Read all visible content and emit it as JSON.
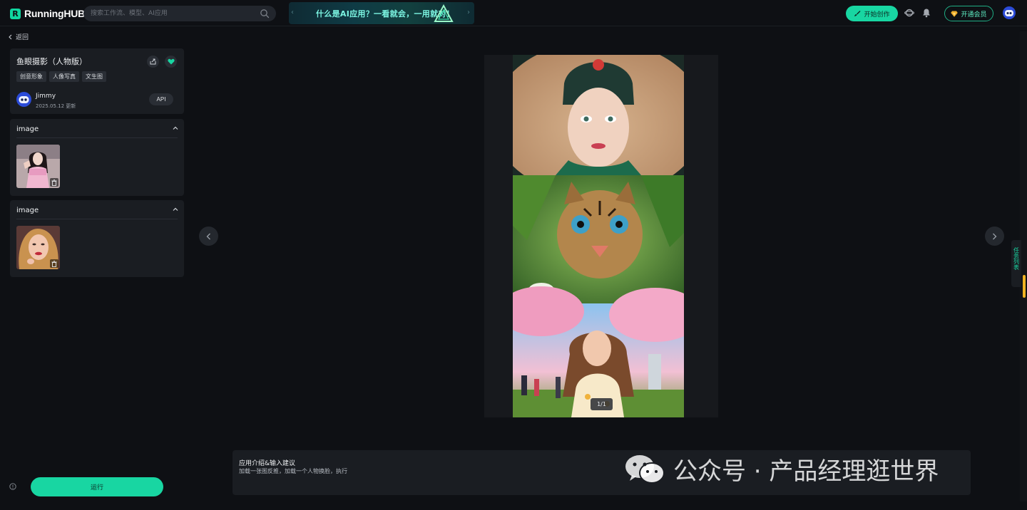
{
  "header": {
    "logo_text": "RunningHUB",
    "logo_mark": "R",
    "search_placeholder": "搜索工作流、模型、AI应用",
    "banner_text": "什么是AI应用？一看就会，一用就对！",
    "banner_prev": "‹",
    "banner_next": "›",
    "create_label": "开始创作",
    "vip_label": "开通会员"
  },
  "back_label": "返回",
  "app_card": {
    "title": "鱼眼摄影（人物版）",
    "tags": [
      "创意形象",
      "人像写真",
      "文生图"
    ],
    "author": "Jimmy",
    "updated": "2025.05.12 更新",
    "api_label": "API"
  },
  "inputs": [
    {
      "label": "image"
    },
    {
      "label": "image"
    }
  ],
  "run_label": "运行",
  "viewer": {
    "page_indicator": "1/1"
  },
  "task_tab_label": "任务列表",
  "intro": {
    "title": "应用介绍&输入建议",
    "text": "加载一张图反推，加载一个人物换脸，执行"
  },
  "watermark": "公众号 · 产品经理逛世界",
  "colors": {
    "accent": "#18d6a2",
    "background": "#0e1014",
    "panel": "#1a1d22"
  }
}
